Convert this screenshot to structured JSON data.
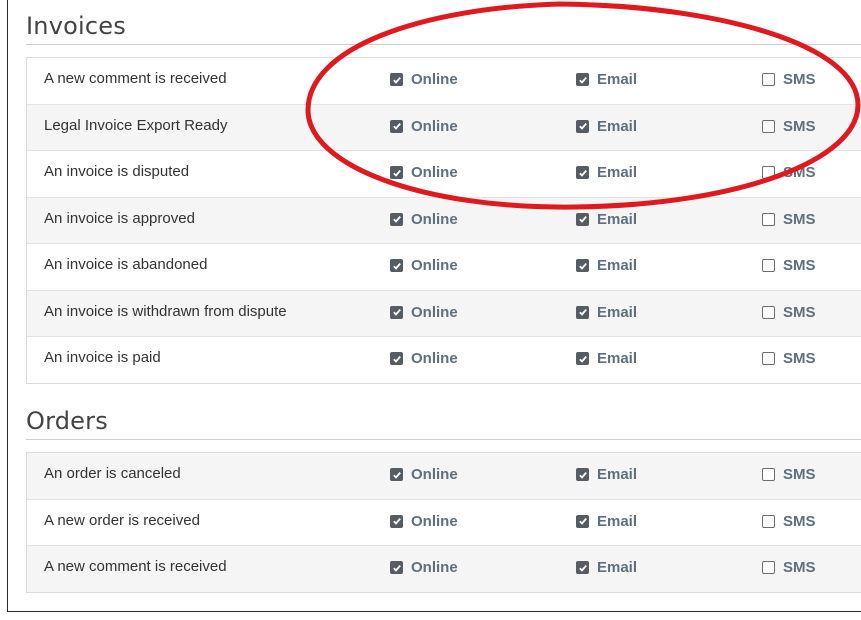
{
  "sections": [
    {
      "title": "Invoices",
      "rows": [
        {
          "label": "A new comment is received",
          "online": true,
          "email": true,
          "sms": false
        },
        {
          "label": "Legal Invoice Export Ready",
          "online": true,
          "email": true,
          "sms": false
        },
        {
          "label": "An invoice is disputed",
          "online": true,
          "email": true,
          "sms": false
        },
        {
          "label": "An invoice is approved",
          "online": true,
          "email": true,
          "sms": false
        },
        {
          "label": "An invoice is abandoned",
          "online": true,
          "email": true,
          "sms": false
        },
        {
          "label": "An invoice is withdrawn from dispute",
          "online": true,
          "email": true,
          "sms": false
        },
        {
          "label": "An invoice is paid",
          "online": true,
          "email": true,
          "sms": false
        }
      ]
    },
    {
      "title": "Orders",
      "rows": [
        {
          "label": "An order is canceled",
          "online": true,
          "email": true,
          "sms": false
        },
        {
          "label": "A new order is received",
          "online": true,
          "email": true,
          "sms": false
        },
        {
          "label": "A new comment is received",
          "online": true,
          "email": true,
          "sms": false
        }
      ]
    }
  ],
  "channels": {
    "online": "Online",
    "email": "Email",
    "sms": "SMS"
  },
  "colors": {
    "annotation": "#e0191e",
    "option_label": "#5e6f7d",
    "checkbox_fill": "#555c63"
  }
}
